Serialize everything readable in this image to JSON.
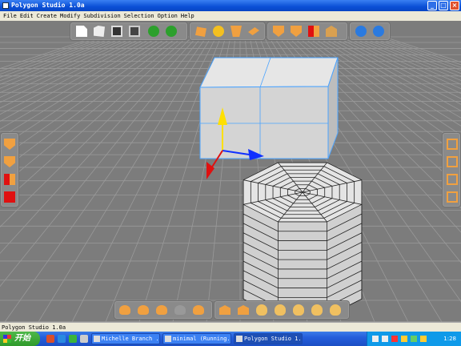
{
  "window": {
    "title": "Polygon Studio 1.0a"
  },
  "menu": [
    "File",
    "Edit",
    "Create",
    "Modify",
    "Subdivision",
    "Selection",
    "Option",
    "Help"
  ],
  "window_buttons": {
    "minimize": "_",
    "maximize": "□",
    "close": "×"
  },
  "status": {
    "text": "Polygon Studio 1.0a"
  },
  "taskbar": {
    "start_label": "开始",
    "tasks": [
      {
        "label": "Michelle Branch ..."
      },
      {
        "label": "minimal (Running..."
      },
      {
        "label": "Polygon Studio 1.0a"
      }
    ],
    "clock": "1:28"
  },
  "colors": {
    "viewport_bg": "#7c7c7c",
    "grid": "#9c9c9c",
    "selection_edge": "#4aa3ff",
    "axis_x": "#1030ff",
    "axis_y": "#ffe000",
    "axis_z": "#e01010",
    "tool_orange": "#f0a040"
  }
}
